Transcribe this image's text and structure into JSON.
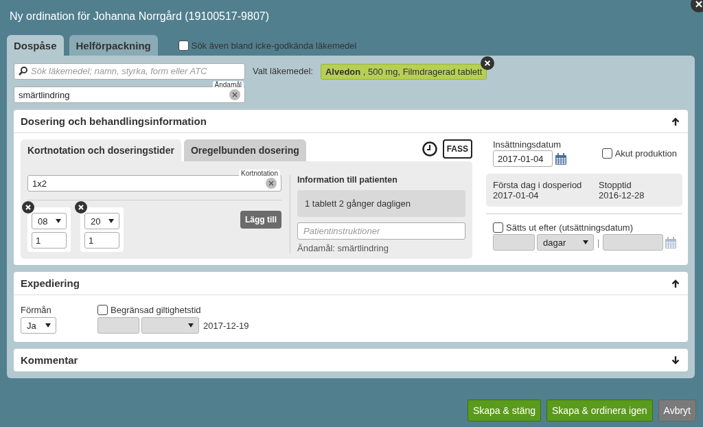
{
  "window": {
    "title": "Ny ordination för Johanna Norrgård (19100517-9807)"
  },
  "tabs": [
    {
      "label": "Dospåse",
      "selected": true
    },
    {
      "label": "Helförpackning",
      "selected": false
    }
  ],
  "include_unapproved": {
    "label": "Sök även bland icke-godkända läkemedel",
    "checked": false
  },
  "search": {
    "placeholder": "Sök läkemedel; namn, styrka, form eller ATC"
  },
  "selected_drug": {
    "label": "Valt läkemedel:",
    "name": "Alvedon",
    "details": ", 500 mg, Filmdragerad tablett"
  },
  "purpose": {
    "floating_label": "Ändamål",
    "value": "smärtlindring"
  },
  "dosing": {
    "title": "Dosering och behandlingsinformation",
    "expanded": true,
    "tabs": [
      {
        "label": "Kortnotation och doseringstider",
        "selected": true
      },
      {
        "label": "Oregelbunden dosering",
        "selected": false
      }
    ],
    "fass": "FASS",
    "short_notation": {
      "floating_label": "Kortnotation",
      "value": "1x2"
    },
    "times": [
      {
        "hour": "08",
        "amount": "1"
      },
      {
        "hour": "20",
        "amount": "1"
      }
    ],
    "add_button": "Lägg till",
    "patient_info": {
      "title": "Information till patienten",
      "text": "1 tablett 2 gånger dagligen",
      "placeholder": "Patientinstruktioner",
      "purpose": "Ändamål: smärtlindring"
    },
    "start_date": {
      "label": "Insättningsdatum",
      "value": "2017-01-04"
    },
    "urgent": {
      "label": "Akut produktion",
      "checked": false
    },
    "first_day": {
      "label": "Första dag i dosperiod",
      "value": "2017-01-04"
    },
    "stop": {
      "label": "Stopptid",
      "value": "2016-12-28"
    },
    "discontinue": {
      "label": "Sätts ut efter (utsättningsdatum)",
      "checked": false,
      "unit": "dagar",
      "separator": "|"
    }
  },
  "dispensing": {
    "title": "Expediering",
    "expanded": true,
    "benefit": {
      "label": "Förmån",
      "value": "Ja"
    },
    "limited": {
      "label": "Begränsad giltighetstid",
      "checked": false,
      "date": "2017-12-19"
    }
  },
  "comment": {
    "title": "Kommentar",
    "expanded": false
  },
  "buttons": [
    {
      "label": "Skapa & stäng",
      "kind": "primary"
    },
    {
      "label": "Skapa & ordinera igen",
      "kind": "primary"
    },
    {
      "label": "Avbryt",
      "kind": "secondary"
    }
  ]
}
